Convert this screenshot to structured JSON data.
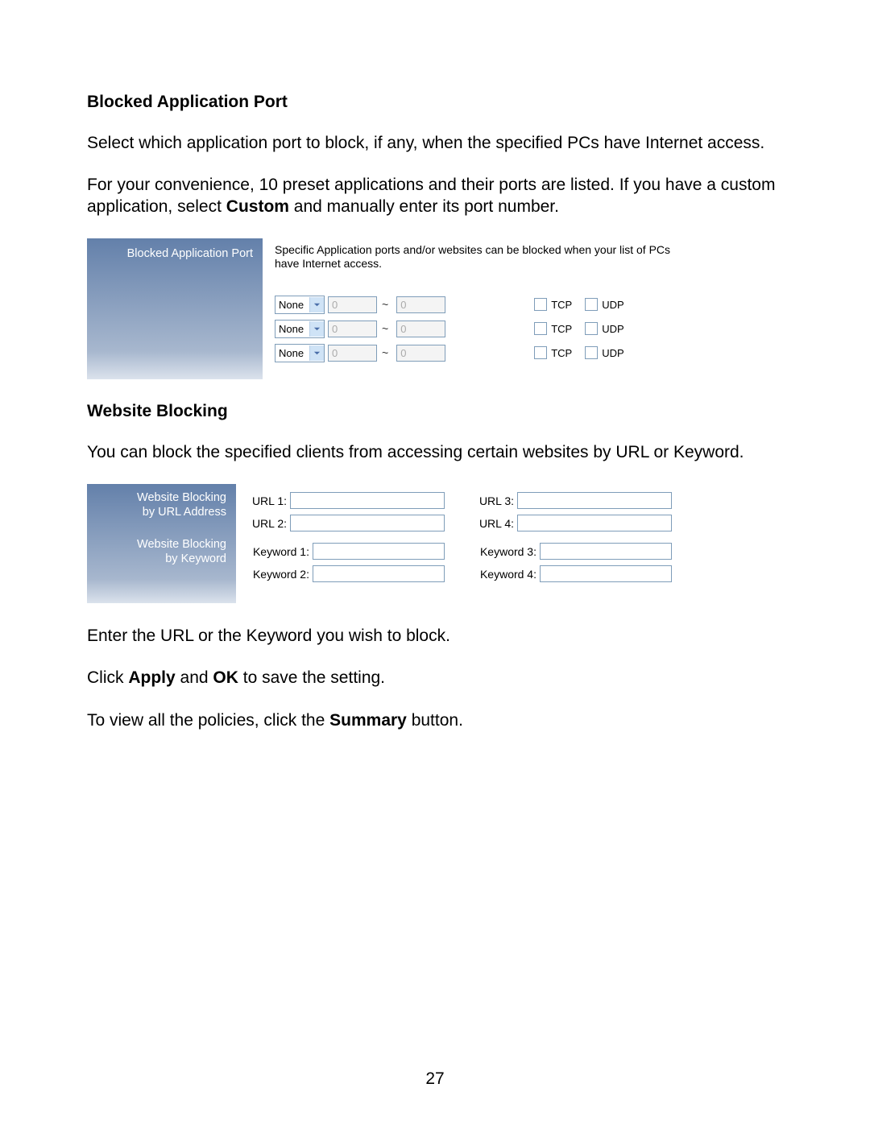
{
  "section1": {
    "heading": "Blocked Application Port",
    "p1": "Select which application port to block, if any, when the specified PCs have Internet access.",
    "p2a": "For your convenience, 10 preset applications and their ports are listed. If you have a custom application, select ",
    "p2b": "Custom",
    "p2c": " and manually enter its port number."
  },
  "shot1": {
    "label": "Blocked Application Port",
    "desc": "Specific Application ports and/or websites can be blocked when your list of PCs have Internet access.",
    "rows": [
      {
        "app": "None",
        "p1": "0",
        "p2": "0",
        "tcp": "TCP",
        "udp": "UDP"
      },
      {
        "app": "None",
        "p1": "0",
        "p2": "0",
        "tcp": "TCP",
        "udp": "UDP"
      },
      {
        "app": "None",
        "p1": "0",
        "p2": "0",
        "tcp": "TCP",
        "udp": "UDP"
      }
    ],
    "tilde": "~"
  },
  "section2": {
    "heading": "Website Blocking",
    "p1": "You can block the specified clients from accessing certain websites by URL or Keyword."
  },
  "shot2": {
    "label_url_a": "Website Blocking",
    "label_url_b": "by URL Address",
    "label_kw_a": "Website Blocking",
    "label_kw_b": "by Keyword",
    "url1": "URL 1:",
    "url2": "URL 2:",
    "url3": "URL 3:",
    "url4": "URL 4:",
    "kw1": "Keyword 1:",
    "kw2": "Keyword 2:",
    "kw3": "Keyword 3:",
    "kw4": "Keyword 4:"
  },
  "footer": {
    "p1": "Enter the URL or the Keyword you wish to block.",
    "p2a": "Click ",
    "p2b": "Apply",
    "p2c": " and ",
    "p2d": "OK",
    "p2e": " to save the setting.",
    "p3a": "To view all the policies, click the ",
    "p3b": "Summary",
    "p3c": " button."
  },
  "pagenum": "27"
}
